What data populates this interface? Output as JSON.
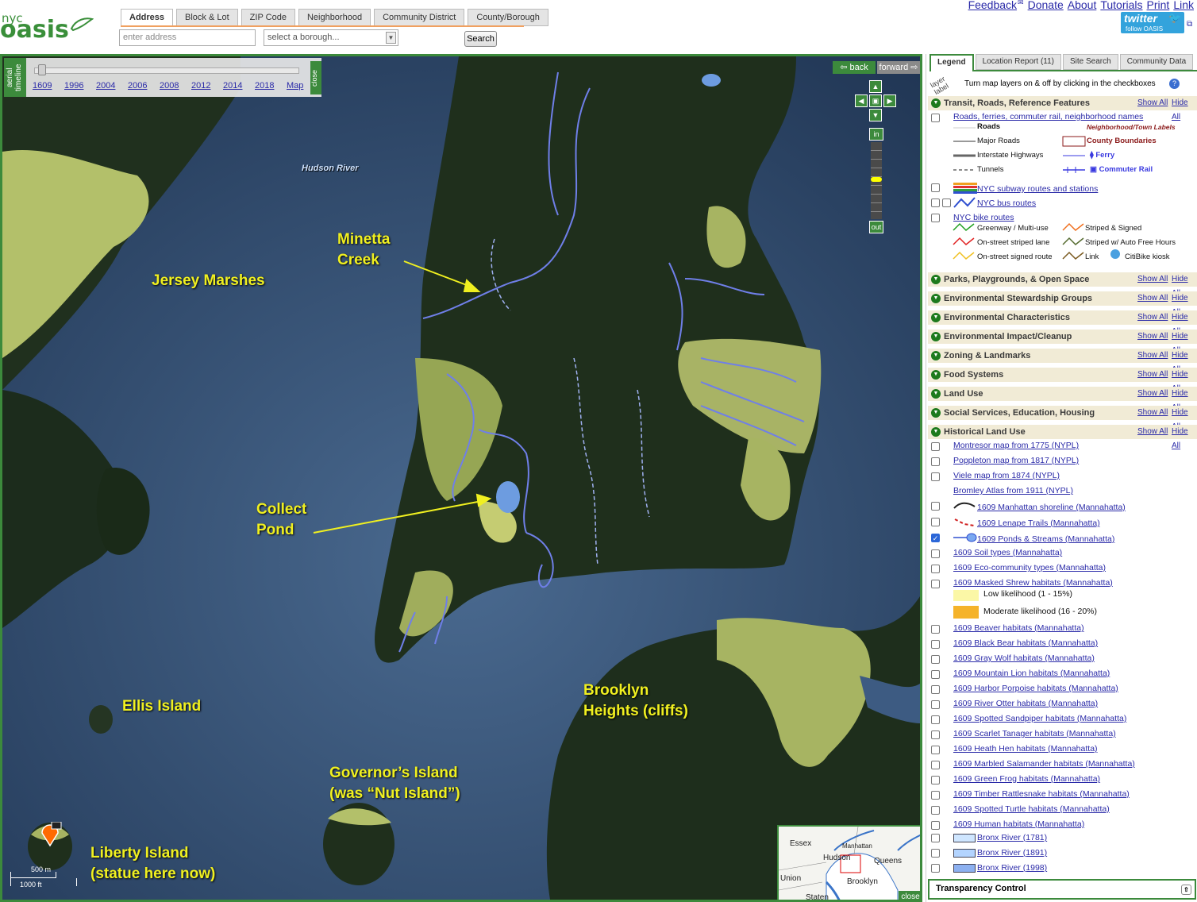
{
  "header": {
    "logo_small": "nyc",
    "logo_big": "oasis",
    "tabs": [
      "Address",
      "Block & Lot",
      "ZIP Code",
      "Neighborhood",
      "Community District",
      "County/Borough"
    ],
    "address_placeholder": "enter address",
    "borough_select": "select a borough...",
    "search_label": "Search",
    "top_links": [
      "Feedback",
      "Donate",
      "About",
      "Tutorials",
      "Print",
      "Link"
    ],
    "twitter_text": "twitter",
    "twitter_sub": "follow OASIS"
  },
  "timeline": {
    "side_label": "aerial timeline",
    "years": [
      "1609",
      "1996",
      "2004",
      "2006",
      "2008",
      "2012",
      "2014",
      "2018",
      "Map"
    ],
    "close": "close"
  },
  "map": {
    "back": "back",
    "forward": "forward",
    "zoom_in": "in",
    "zoom_out": "out",
    "water_label": "Hudson River",
    "labels": {
      "minetta": "Minetta\nCreek",
      "jersey": "Jersey Marshes",
      "collect": "Collect\nPond",
      "brooklyn": "Brooklyn\nHeights (cliffs)",
      "ellis": "Ellis Island",
      "governors": "Governor’s Island\n(was “Nut Island”)",
      "liberty": "Liberty Island\n(statue here now)"
    },
    "scale_top": "500 m",
    "scale_bottom": "1000 ft",
    "minimap": {
      "labels": [
        "Essex",
        "Manhattan",
        "Hudson",
        "Queens",
        "Union",
        "Brooklyn",
        "Staten"
      ],
      "close": "close"
    }
  },
  "panel": {
    "tabs": [
      "Legend",
      "Location Report (11)",
      "Site Search",
      "Community Data"
    ],
    "layer_label": "layer label",
    "instructions": "Turn map layers on & off by clicking in the checkboxes",
    "show_all": "Show All",
    "hide_all": "Hide All",
    "transit_title": "Transit, Roads, Reference Features",
    "roads_link": "Roads, ferries, commuter rail, neighborhood names",
    "road_legend": {
      "roads": "Roads",
      "major": "Major Roads",
      "interstate": "Interstate Highways",
      "tunnels": "Tunnels",
      "neigh": "Neighborhood/Town Labels",
      "county": "County Boundaries",
      "ferry": "Ferry",
      "rail": "Commuter Rail"
    },
    "subway_link": "NYC subway routes and stations",
    "bus_link": "NYC bus routes",
    "bike_link": "NYC bike routes",
    "bike_legend": {
      "greenway": "Greenway / Multi-use",
      "striped_signed": "Striped & Signed",
      "onstreet_lane": "On-street striped lane",
      "autofree": "Striped w/ Auto Free Hours",
      "onstreet_signed": "On-street signed route",
      "link": "Link",
      "citibike": "CitiBike kiosk"
    },
    "sections": [
      "Parks, Playgrounds, & Open Space",
      "Environmental Stewardship Groups",
      "Environmental Characteristics",
      "Environmental Impact/Cleanup",
      "Zoning & Landmarks",
      "Food Systems",
      "Land Use",
      "Social Services, Education, Housing",
      "Historical Land Use"
    ],
    "historical": {
      "maps": [
        "Montresor map from 1775 (NYPL)",
        "Poppleton map from 1817 (NYPL)",
        "Viele map from 1874 (NYPL)",
        "Bromley Atlas from 1911 (NYPL)"
      ],
      "shoreline": "1609 Manhattan shoreline (Mannahatta)",
      "trails": "1609 Lenape Trails (Mannahatta)",
      "ponds": "1609 Ponds & Streams (Mannahatta)",
      "soil": "1609 Soil types (Mannahatta)",
      "eco": "1609 Eco-community types (Mannahatta)",
      "shrew": "1609 Masked Shrew habitats (Mannahatta)",
      "low": "Low likelihood (1 - 15%)",
      "moderate": "Moderate likelihood (16 - 20%)",
      "habitats": [
        "1609 Beaver habitats (Mannahatta)",
        "1609 Black Bear habitats (Mannahatta)",
        "1609 Gray Wolf habitats (Mannahatta)",
        "1609 Mountain Lion habitats (Mannahatta)",
        "1609 Harbor Porpoise habitats (Mannahatta)",
        "1609 River Otter habitats (Mannahatta)",
        "1609 Spotted Sandpiper habitats (Mannahatta)",
        "1609 Scarlet Tanager habitats (Mannahatta)",
        "1609 Heath Hen habitats (Mannahatta)",
        "1609 Marbled Salamander habitats (Mannahatta)",
        "1609 Green Frog habitats (Mannahatta)",
        "1609 Timber Rattlesnake habitats (Mannahatta)",
        "1609 Spotted Turtle habitats (Mannahatta)",
        "1609 Human habitats (Mannahatta)"
      ],
      "bronx": [
        "Bronx River (1781)",
        "Bronx River (1891)",
        "Bronx River (1998)"
      ]
    },
    "transparency": "Transparency Control"
  },
  "colors": {
    "accent_green": "#3c8a3c",
    "label_yellow": "#f0f020",
    "link_blue": "#2a2aa8",
    "low_likelihood": "#fbf7a6",
    "moderate_likelihood": "#f5b32a"
  }
}
